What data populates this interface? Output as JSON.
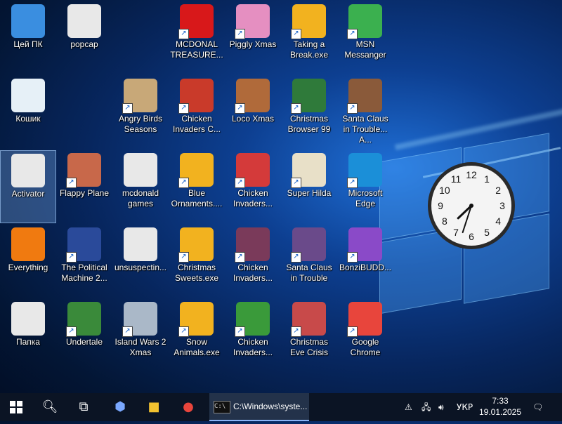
{
  "desktop": {
    "icons": [
      {
        "label": "Цей ПК",
        "icon": "this-pc-icon",
        "color": "#3a8ee0"
      },
      {
        "label": "popcap",
        "icon": "popcap-folder-icon",
        "color": "#e8e8e8"
      },
      {
        "label": "MCDONAL TREASURE...",
        "icon": "mcdonalds-icon",
        "color": "#d8181a"
      },
      {
        "label": "Piggly Xmas",
        "icon": "piggly-xmas-icon",
        "color": "#e58fc1"
      },
      {
        "label": "Taking a Break.exe",
        "icon": "puzzle-app-icon",
        "color": "#f2b21f"
      },
      {
        "label": "MSN Messanger",
        "icon": "msn-messenger-icon",
        "color": "#3bb04f"
      },
      {
        "label": "Кошик",
        "icon": "recycle-bin-icon",
        "color": "#e6f0f7"
      },
      {
        "label": "Angry Birds Seasons",
        "icon": "angry-birds-icon",
        "color": "#c8a878"
      },
      {
        "label": "Chicken Invaders C...",
        "icon": "chicken-invaders-xmas-icon",
        "color": "#c93a2a"
      },
      {
        "label": "Loco Xmas",
        "icon": "loco-xmas-icon",
        "color": "#b06a3a"
      },
      {
        "label": "Christmas Browser 99",
        "icon": "christmas-tree-icon",
        "color": "#2f7a3a"
      },
      {
        "label": "Santa Claus in Trouble... A...",
        "icon": "santa-claus-icon",
        "color": "#8a5a3a"
      },
      {
        "label": "Activator",
        "icon": "activator-folder-icon",
        "color": "#e8e8e8"
      },
      {
        "label": "Flappy Plane",
        "icon": "flappy-plane-icon",
        "color": "#c8684a"
      },
      {
        "label": "mcdonald games",
        "icon": "mcdonald-games-folder-icon",
        "color": "#e8e8e8"
      },
      {
        "label": "Blue Ornaments....",
        "icon": "puzzle-app-icon",
        "color": "#f2b21f"
      },
      {
        "label": "Chicken Invaders...",
        "icon": "chicken-invaders-icon",
        "color": "#d43a3a"
      },
      {
        "label": "Super Hilda",
        "icon": "super-hilda-icon",
        "color": "#e8e0c8"
      },
      {
        "label": "Microsoft Edge",
        "icon": "edge-icon",
        "color": "#1b8fd8"
      },
      {
        "label": "Everything",
        "icon": "everything-search-icon",
        "color": "#f07a10"
      },
      {
        "label": "The Political Machine 2...",
        "icon": "political-machine-icon",
        "color": "#2a4a9a"
      },
      {
        "label": "unsuspectin...",
        "icon": "unsuspecting-folder-icon",
        "color": "#e8e8e8"
      },
      {
        "label": "Christmas Sweets.exe",
        "icon": "puzzle-app-icon",
        "color": "#f2b21f"
      },
      {
        "label": "Chicken Invaders...",
        "icon": "chicken-invaders-icon",
        "color": "#7a3a5a"
      },
      {
        "label": "Santa Claus in Trouble",
        "icon": "santa-claus-icon",
        "color": "#6a4a8a"
      },
      {
        "label": "BonziBUDD...",
        "icon": "bonzibuddy-icon",
        "color": "#8a4ac8"
      },
      {
        "label": "Папка",
        "icon": "folder-icon",
        "color": "#e8e8e8"
      },
      {
        "label": "Undertale",
        "icon": "undertale-icon",
        "color": "#3a8a3a"
      },
      {
        "label": "Island Wars 2 Xmas",
        "icon": "island-wars-icon",
        "color": "#aab8c8"
      },
      {
        "label": "Snow Animals.exe",
        "icon": "puzzle-app-icon",
        "color": "#f2b21f"
      },
      {
        "label": "Chicken Invaders...",
        "icon": "chicken-invaders-icon",
        "color": "#3a9a3a"
      },
      {
        "label": "Christmas Eve Crisis",
        "icon": "christmas-eve-crisis-icon",
        "color": "#c84a4a"
      },
      {
        "label": "Google Chrome",
        "icon": "chrome-icon",
        "color": "#e8453c"
      }
    ]
  },
  "clock_gadget": {
    "hour": 7,
    "minute": 33,
    "numerals": [
      "12",
      "1",
      "2",
      "3",
      "4",
      "5",
      "6",
      "7",
      "8",
      "9",
      "10",
      "11"
    ]
  },
  "taskbar": {
    "start_icon": "windows-start-icon",
    "search_icon": "search-icon",
    "taskview_icon": "task-view-icon",
    "pinned": [
      "copilot-icon",
      "file-explorer-icon",
      "chrome-icon"
    ],
    "active_window": "C:\\Windows\\syste...",
    "tray_lang": "УКР",
    "time": "7:33",
    "date": "19.01.2025"
  }
}
